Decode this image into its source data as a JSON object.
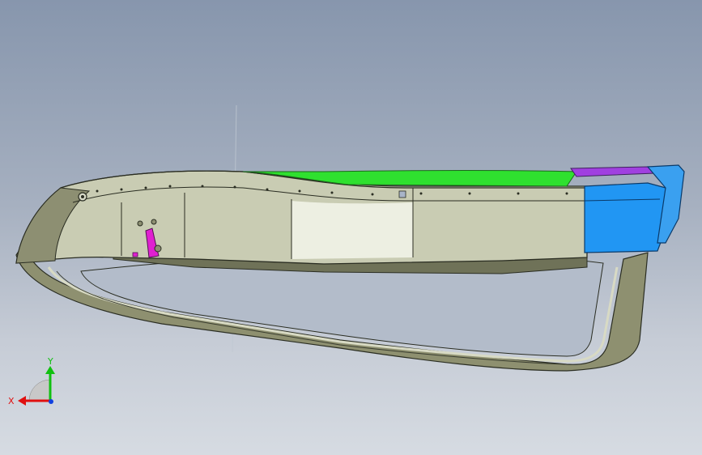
{
  "viewport": {
    "background_top": "#8796ad",
    "background_bottom": "#d6dbe2"
  },
  "model": {
    "body_color": "#c9ccb3",
    "edge_color": "#2a2d22",
    "highlight_green": "#2fe02f",
    "highlight_blue": "#2196f3",
    "highlight_purple": "#a040e0",
    "highlight_magenta": "#e020d0"
  },
  "triad": {
    "x_label": "X",
    "y_label": "Y",
    "x_color": "#e01010",
    "y_color": "#10c010",
    "z_color": "#1040e0"
  }
}
